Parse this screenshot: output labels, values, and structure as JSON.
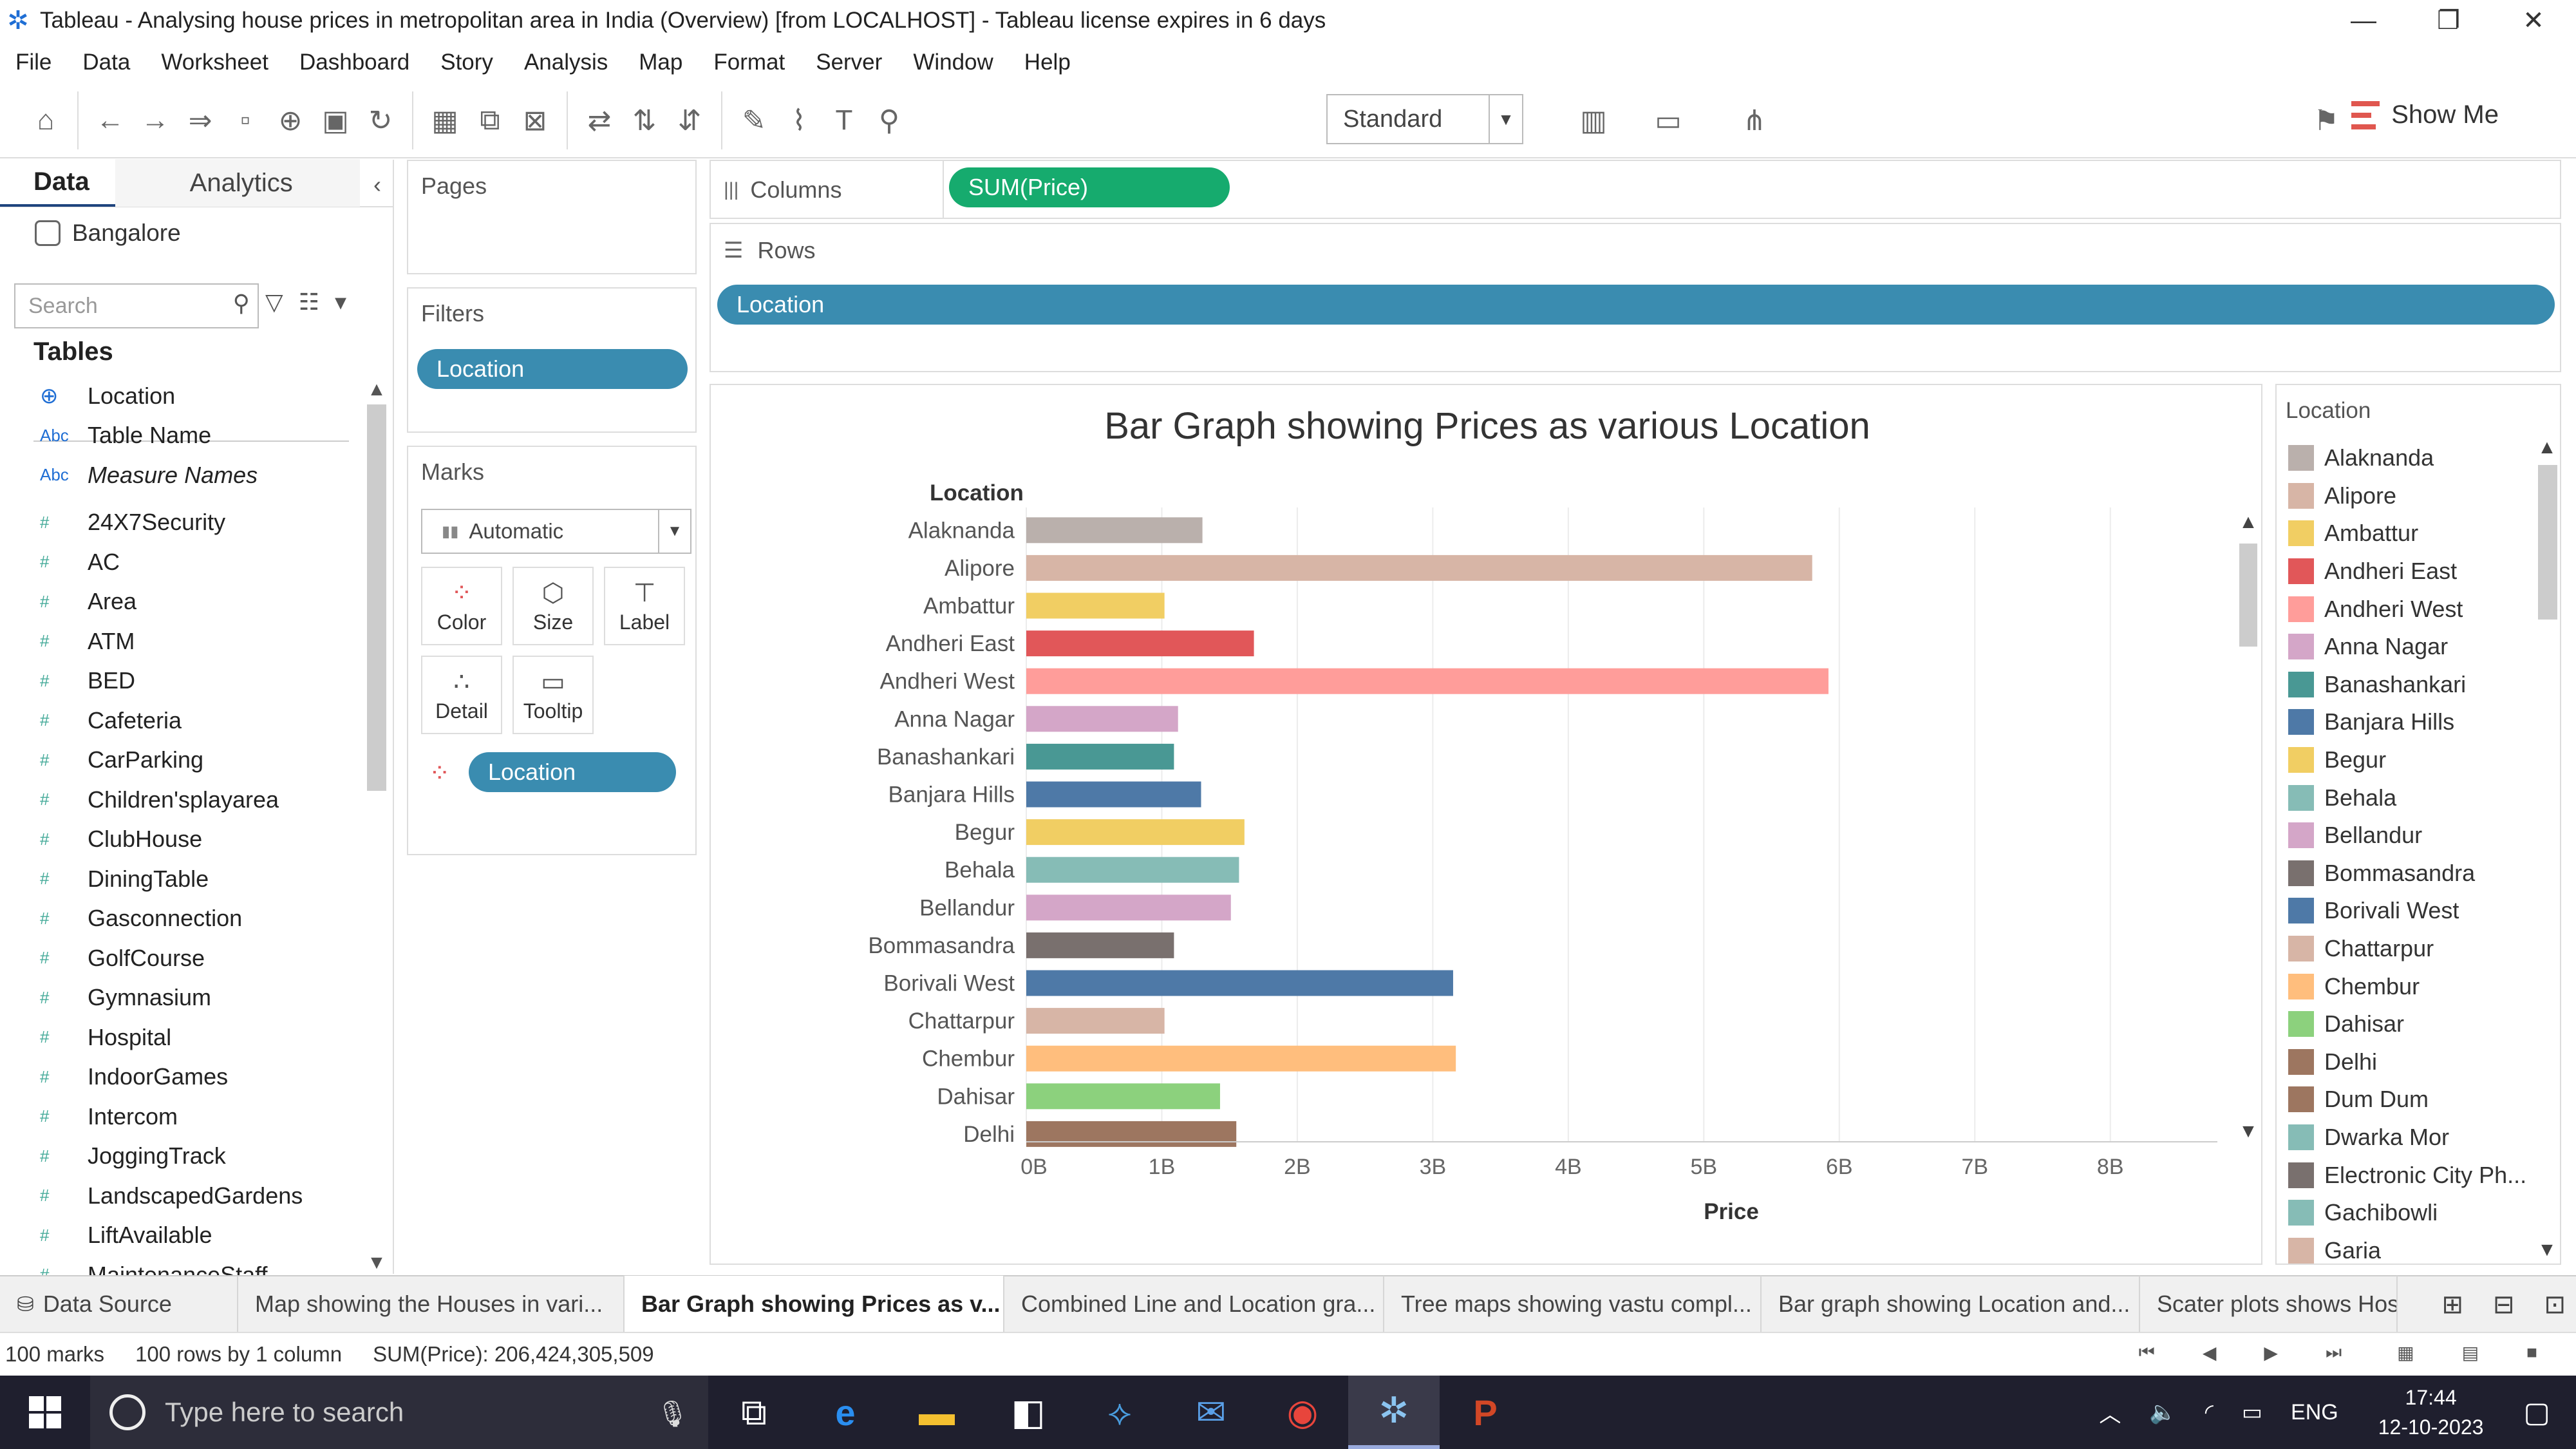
{
  "window": {
    "title": "Tableau - Analysing house prices in metropolitan area in India (Overview) [from LOCALHOST] - Tableau license expires in 6 days",
    "minimize": "—",
    "restore": "❐",
    "close": "✕"
  },
  "menu": [
    "File",
    "Data",
    "Worksheet",
    "Dashboard",
    "Story",
    "Analysis",
    "Map",
    "Format",
    "Server",
    "Window",
    "Help"
  ],
  "toolbar": {
    "fit_select": "Standard",
    "show_me": "Show Me"
  },
  "data_pane": {
    "tab_data": "Data",
    "tab_analytics": "Analytics",
    "datasource": "Bangalore",
    "search_placeholder": "Search",
    "tables_heading": "Tables",
    "fields": [
      {
        "type": "geo",
        "name": "Location"
      },
      {
        "type": "abc",
        "name": "Table Name"
      },
      {
        "type": "abc",
        "name": "Measure Names"
      },
      {
        "type": "num",
        "name": "24X7Security"
      },
      {
        "type": "num",
        "name": "AC"
      },
      {
        "type": "num",
        "name": "Area"
      },
      {
        "type": "num",
        "name": "ATM"
      },
      {
        "type": "num",
        "name": "BED"
      },
      {
        "type": "num",
        "name": "Cafeteria"
      },
      {
        "type": "num",
        "name": "CarParking"
      },
      {
        "type": "num",
        "name": "Children'splayarea"
      },
      {
        "type": "num",
        "name": "ClubHouse"
      },
      {
        "type": "num",
        "name": "DiningTable"
      },
      {
        "type": "num",
        "name": "Gasconnection"
      },
      {
        "type": "num",
        "name": "GolfCourse"
      },
      {
        "type": "num",
        "name": "Gymnasium"
      },
      {
        "type": "num",
        "name": "Hospital"
      },
      {
        "type": "num",
        "name": "IndoorGames"
      },
      {
        "type": "num",
        "name": "Intercom"
      },
      {
        "type": "num",
        "name": "JoggingTrack"
      },
      {
        "type": "num",
        "name": "LandscapedGardens"
      },
      {
        "type": "num",
        "name": "LiftAvailable"
      },
      {
        "type": "num",
        "name": "MaintenanceStaff"
      }
    ]
  },
  "cards": {
    "pages": "Pages",
    "filters": "Filters",
    "filter_pill": "Location",
    "marks": "Marks",
    "mark_type": "Automatic",
    "mark_buttons": [
      "Color",
      "Size",
      "Label",
      "Detail",
      "Tooltip"
    ],
    "marks_pill": "Location"
  },
  "shelves": {
    "columns_label": "Columns",
    "columns_pill": "SUM(Price)",
    "rows_label": "Rows",
    "rows_pill": "Location"
  },
  "chart_data": {
    "type": "bar",
    "orientation": "horizontal",
    "title": "Bar Graph showing Prices as various Location",
    "row_header": "Location",
    "xlabel": "Price",
    "x_ticks": [
      "0B",
      "1B",
      "2B",
      "3B",
      "4B",
      "5B",
      "6B",
      "7B",
      "8B"
    ],
    "xlim": [
      0,
      8600000000
    ],
    "categories": [
      "Alaknanda",
      "Alipore",
      "Ambattur",
      "Andheri East",
      "Andheri West",
      "Anna Nagar",
      "Banashankari",
      "Banjara Hills",
      "Begur",
      "Behala",
      "Bellandur",
      "Bommasandra",
      "Borivali West",
      "Chattarpur",
      "Chembur",
      "Dahisar",
      "Delhi"
    ],
    "values": [
      1300000000,
      5800000000,
      1020000000,
      1680000000,
      5920000000,
      1120000000,
      1090000000,
      1290000000,
      1610000000,
      1570000000,
      1510000000,
      1090000000,
      3150000000,
      1020000000,
      3170000000,
      1430000000,
      1550000000
    ],
    "colors": [
      "#bab0ac",
      "#d7b5a6",
      "#f1ce63",
      "#e15759",
      "#ff9d9a",
      "#d4a6c8",
      "#499894",
      "#4e79a7",
      "#f1ce63",
      "#86bcb6",
      "#d4a6c8",
      "#79706e",
      "#4e79a7",
      "#d7b5a6",
      "#ffbe7d",
      "#8cd17d",
      "#9d7660"
    ]
  },
  "legend": {
    "title": "Location",
    "items": [
      {
        "label": "Alaknanda",
        "color": "#bab0ac"
      },
      {
        "label": "Alipore",
        "color": "#d7b5a6"
      },
      {
        "label": "Ambattur",
        "color": "#f1ce63"
      },
      {
        "label": "Andheri East",
        "color": "#e15759"
      },
      {
        "label": "Andheri West",
        "color": "#ff9d9a"
      },
      {
        "label": "Anna Nagar",
        "color": "#d4a6c8"
      },
      {
        "label": "Banashankari",
        "color": "#499894"
      },
      {
        "label": "Banjara Hills",
        "color": "#4e79a7"
      },
      {
        "label": "Begur",
        "color": "#f1ce63"
      },
      {
        "label": "Behala",
        "color": "#86bcb6"
      },
      {
        "label": "Bellandur",
        "color": "#d4a6c8"
      },
      {
        "label": "Bommasandra",
        "color": "#79706e"
      },
      {
        "label": "Borivali West",
        "color": "#4e79a7"
      },
      {
        "label": "Chattarpur",
        "color": "#d7b5a6"
      },
      {
        "label": "Chembur",
        "color": "#ffbe7d"
      },
      {
        "label": "Dahisar",
        "color": "#8cd17d"
      },
      {
        "label": "Delhi",
        "color": "#9d7660"
      },
      {
        "label": "Dum Dum",
        "color": "#9d7660"
      },
      {
        "label": "Dwarka Mor",
        "color": "#86bcb6"
      },
      {
        "label": "Electronic City Ph...",
        "color": "#79706e"
      },
      {
        "label": "Gachibowli",
        "color": "#86bcb6"
      },
      {
        "label": "Garia",
        "color": "#d7b5a6"
      }
    ]
  },
  "sheet_tabs": {
    "data_source": "Data Source",
    "tabs": [
      {
        "label": "Map showing the Houses in vari...",
        "active": false
      },
      {
        "label": "Bar Graph showing Prices as v...",
        "active": true
      },
      {
        "label": "Combined Line and Location gra...",
        "active": false
      },
      {
        "label": "Tree maps showing vastu compl...",
        "active": false
      },
      {
        "label": "Bar graph showing Location and...",
        "active": false
      },
      {
        "label": "Scater plots shows Hosp",
        "active": false
      }
    ]
  },
  "status": {
    "marks": "100 marks",
    "rows": "100 rows by 1 column",
    "sum": "SUM(Price): 206,424,305,509"
  },
  "taskbar": {
    "search_placeholder": "Type here to search",
    "lang": "ENG",
    "time": "17:44",
    "date": "12-10-2023"
  }
}
